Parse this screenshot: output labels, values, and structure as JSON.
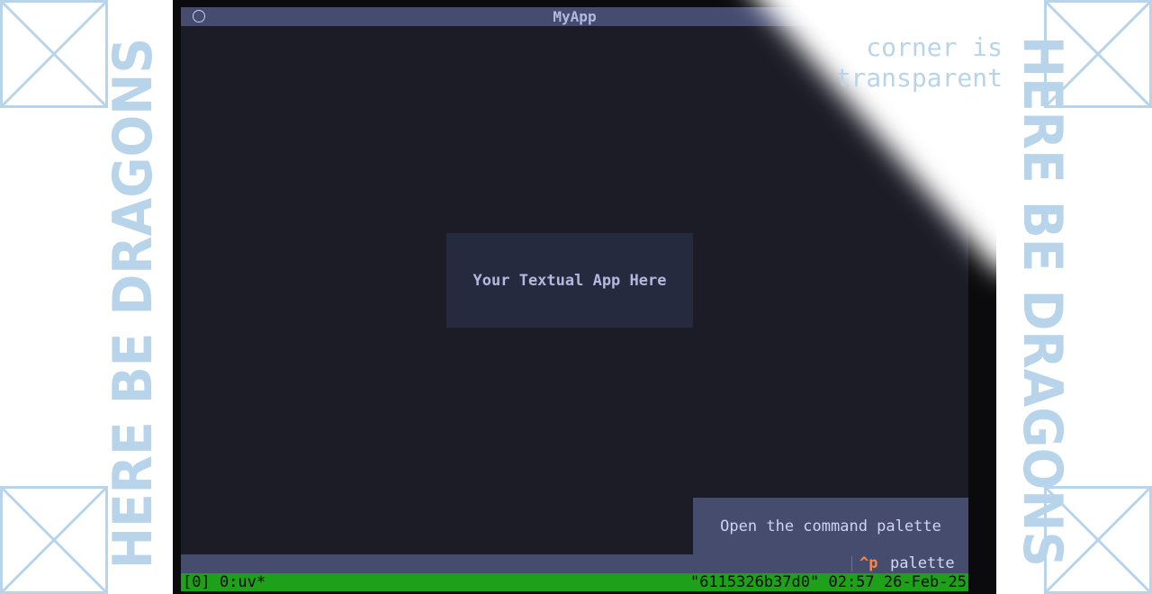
{
  "window": {
    "title": "MyApp",
    "icon": "circle-icon"
  },
  "content": {
    "placeholder": "Your Textual App Here"
  },
  "tooltip": {
    "text": "Open the command palette"
  },
  "footer": {
    "key": "^p",
    "label": "palette"
  },
  "corner_note": {
    "line1": "corner is",
    "line2": "transparent"
  },
  "status_bar": {
    "left": "[0] 0:uv*",
    "right": "\"6115326b37d0\" 02:57 26-Feb-25"
  },
  "decoration": {
    "dragons_text": "HERE BE DRAGONS",
    "placeholder_icon": "crossed-box-icon"
  },
  "colors": {
    "app_background": "#1c1c27",
    "panel": "#464c6e",
    "accent_key": "#f08a4b",
    "status_bar": "#1ea01a",
    "decoration": "#b8d4ea"
  }
}
